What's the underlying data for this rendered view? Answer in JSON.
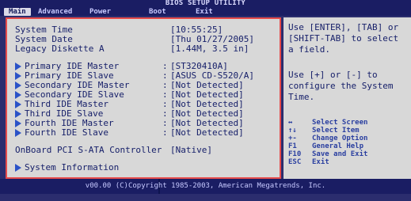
{
  "bios": {
    "title": "BIOS SETUP UTILITY",
    "tabs": [
      "Main",
      "Advanced",
      "Power",
      "Boot",
      "Exit"
    ],
    "active_tab": "Main"
  },
  "main": {
    "system_time_label": "System Time",
    "system_time_value": "[10:55:25]",
    "system_date_label": "System Date",
    "system_date_value": "[Thu 01/27/2005]",
    "legacy_diskette_label": "Legacy Diskette A",
    "legacy_diskette_value": "[1.44M, 3.5 in]",
    "ide_items": [
      {
        "label": "Primary IDE Master",
        "value": "[ST320410A]"
      },
      {
        "label": "Primary IDE Slave",
        "value": "[ASUS CD-S520/A]"
      },
      {
        "label": "Secondary IDE Master",
        "value": "[Not Detected]"
      },
      {
        "label": "Secondary IDE Slave",
        "value": "[Not Detected]"
      },
      {
        "label": "Third IDE Master",
        "value": "[Not Detected]"
      },
      {
        "label": "Third IDE Slave",
        "value": "[Not Detected]"
      },
      {
        "label": "Fourth IDE Master",
        "value": "[Not Detected]"
      },
      {
        "label": "Fourth IDE Slave",
        "value": "[Not Detected]"
      }
    ],
    "onboard_pci_sata_label": "OnBoard PCI S-ATA Controller",
    "onboard_pci_sata_value": "[Native]",
    "system_information_label": "System Information"
  },
  "help": {
    "lines": [
      "Use [ENTER], [TAB] or",
      "[SHIFT-TAB] to select",
      "a field.",
      "",
      "Use [+] or [-] to",
      "configure the System",
      "Time."
    ]
  },
  "keys": [
    {
      "key": "↔",
      "desc": "Select Screen"
    },
    {
      "key": "↑↓",
      "desc": "Select Item"
    },
    {
      "key": "+-",
      "desc": "Change Option"
    },
    {
      "key": "F1",
      "desc": "General Help"
    },
    {
      "key": "F10",
      "desc": "Save and Exit"
    },
    {
      "key": "ESC",
      "desc": "Exit"
    }
  ],
  "footer": {
    "copyright": "v00.00 (C)Copyright 1985-2003, American Megatrends, Inc."
  }
}
